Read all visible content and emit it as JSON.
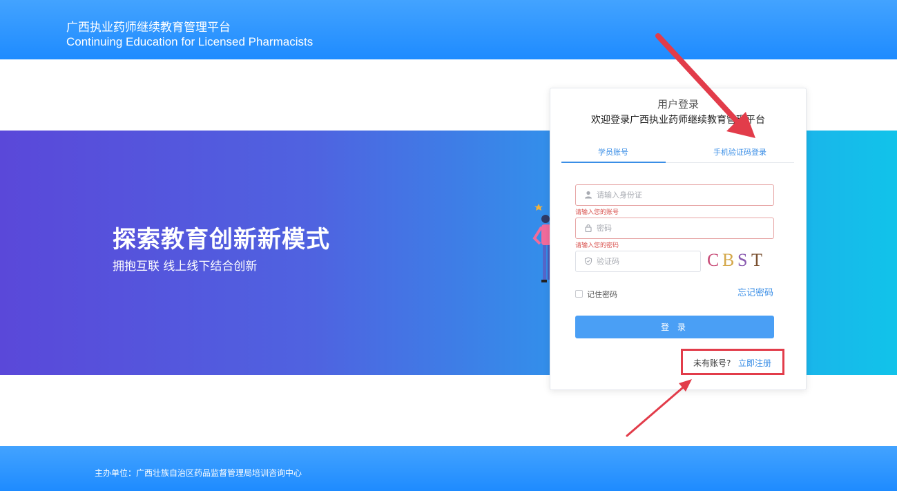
{
  "header": {
    "title_cn": "广西执业药师继续教育管理平台",
    "title_en": "Continuing Education for Licensed Pharmacists"
  },
  "banner": {
    "headline": "探索教育创新新模式",
    "subline": "拥抱互联  线上线下结合创新"
  },
  "login": {
    "card_title": "用户登录",
    "welcome": "欢迎登录广西执业药师继续教育管理平台",
    "tabs": [
      {
        "label": "学员账号",
        "active": true
      },
      {
        "label": "手机验证码登录",
        "active": false
      }
    ],
    "id_placeholder": "请输入身份证",
    "id_error": "请输入您的账号",
    "password_placeholder": "密码",
    "password_error": "请输入您的密码",
    "captcha_placeholder": "验证码",
    "captcha_text": [
      "C",
      "B",
      "S",
      "T"
    ],
    "remember_label": "记住密码",
    "forgot_label": "忘记密码",
    "submit_label": "登 录",
    "no_account": "未有账号?",
    "register_label": "立即注册"
  },
  "footer": {
    "organizer": "主办单位：广西壮族自治区药品监督管理局培训咨询中心"
  },
  "colors": {
    "accent": "#3a8ee6",
    "annotation_red": "#e23c4a"
  }
}
